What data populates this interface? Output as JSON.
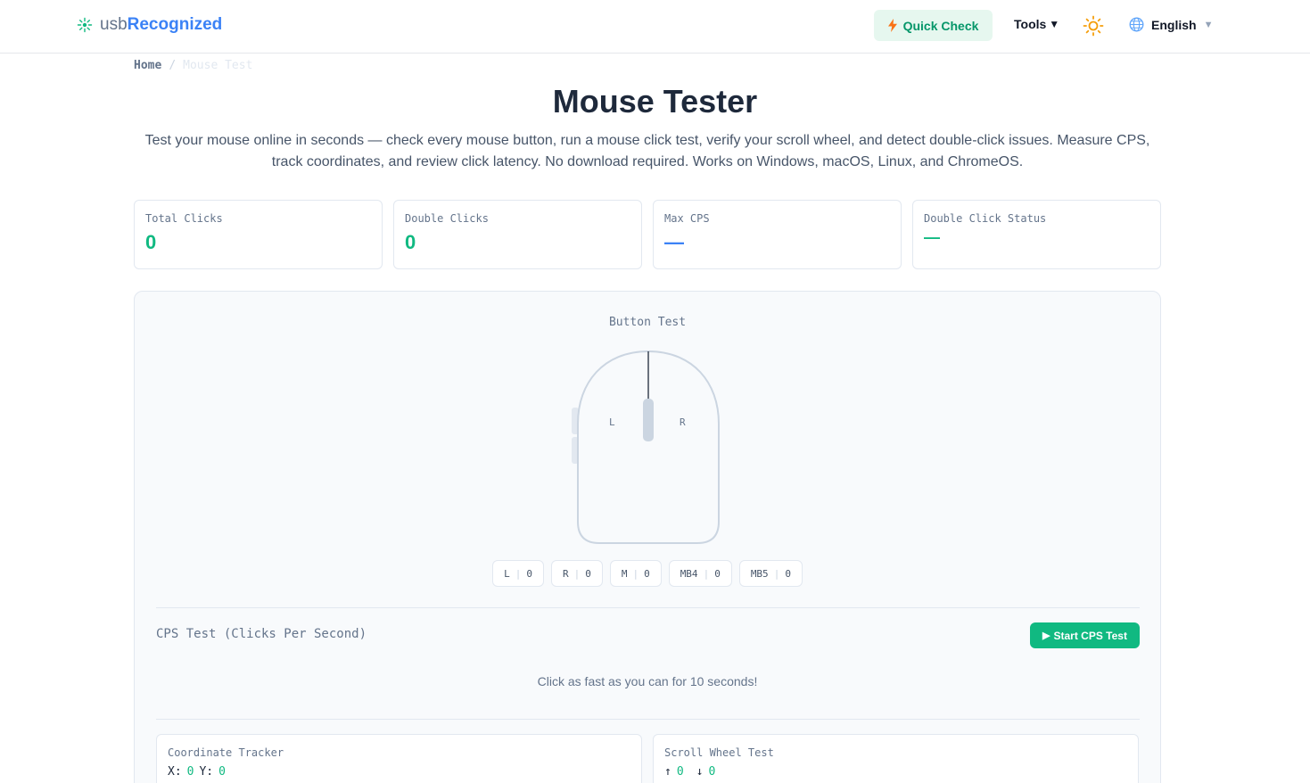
{
  "header": {
    "logo_prefix": "usb",
    "logo_suffix": "Recognized",
    "quick_check": "Quick Check",
    "tools": "Tools",
    "tools_caret": "▼",
    "language": "English",
    "language_caret": "▼"
  },
  "breadcrumb": {
    "home": "Home",
    "separator": "/",
    "current": "Mouse Test"
  },
  "page": {
    "title": "Mouse Tester",
    "intro": "Test your mouse online in seconds — check every mouse button, run a mouse click test, verify your scroll wheel, and detect double-click issues. Measure CPS, track coordinates, and review click latency. No download required. Works on Windows, macOS, Linux, and ChromeOS."
  },
  "stats": [
    {
      "label": "Total Clicks",
      "value": "0"
    },
    {
      "label": "Double Clicks",
      "value": "0"
    },
    {
      "label": "Max CPS",
      "value": "—"
    },
    {
      "label": "Double Click Status",
      "value": "—"
    }
  ],
  "button_test": {
    "title": "Button Test",
    "left_label": "L",
    "right_label": "R",
    "counters": [
      {
        "name": "L",
        "count": "0"
      },
      {
        "name": "R",
        "count": "0"
      },
      {
        "name": "M",
        "count": "0"
      },
      {
        "name": "MB4",
        "count": "0"
      },
      {
        "name": "MB5",
        "count": "0"
      }
    ],
    "counter_separator": "|"
  },
  "cps": {
    "title": "CPS Test (Clicks Per Second)",
    "button": "Start CPS Test",
    "button_icon": "▶",
    "hint": "Click as fast as you can for 10 seconds!"
  },
  "coordinates": {
    "title": "Coordinate Tracker",
    "x_label": "X:",
    "x_value": "0",
    "y_label": "Y:",
    "y_value": "0"
  },
  "scroll": {
    "title": "Scroll Wheel Test",
    "up_arrow": "↑",
    "up_value": "0",
    "down_arrow": "↓",
    "down_value": "0"
  },
  "colors": {
    "accent_green": "#10b981",
    "accent_blue": "#3b82f6",
    "quick_check_bg": "#e6f7ef"
  }
}
